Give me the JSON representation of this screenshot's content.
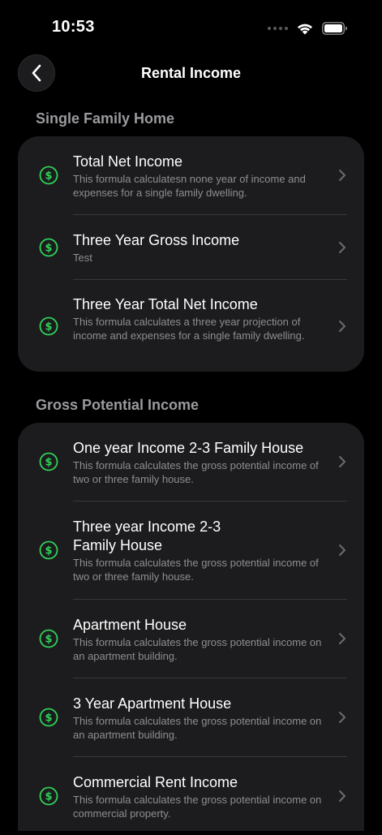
{
  "status_bar": {
    "time": "10:53"
  },
  "nav": {
    "title": "Rental Income",
    "back_icon": "chevron-left-icon"
  },
  "colors": {
    "background": "#000000",
    "card": "#1c1c1e",
    "accent_green": "#30d158",
    "secondary_text": "#8e8e93",
    "section_header": "#9a9a9f"
  },
  "sections": [
    {
      "header": "Single Family Home",
      "items": [
        {
          "title": "Total Net Income",
          "description": "This formula calculatesn none  year of income and expenses for a single family dwelling.",
          "icon": "dollar-circle-icon"
        },
        {
          "title": "Three Year Gross Income",
          "description": "Test",
          "icon": "dollar-circle-icon"
        },
        {
          "title": "Three Year Total Net Income",
          "description": "This formula calculates a three  year projection of income and expenses for a single family dwelling.",
          "icon": "dollar-circle-icon"
        }
      ]
    },
    {
      "header": "Gross Potential Income",
      "items": [
        {
          "title": "One year Income 2-3 Family House",
          "description": "This formula calculates the gross potential income of two or three family house.",
          "icon": "dollar-circle-icon"
        },
        {
          "title": "Three  year Income 2-3 Family House",
          "description": "This formula calculates the gross potential income of two or three family house.",
          "icon": "dollar-circle-icon"
        },
        {
          "title": "Apartment House",
          "description": "This formula calculates the gross potential income on an apartment building.",
          "icon": "dollar-circle-icon"
        },
        {
          "title": "3 Year Apartment House",
          "description": "This formula calculates the gross potential income on an apartment building.",
          "icon": "dollar-circle-icon"
        },
        {
          "title": "Commercial Rent Income",
          "description": "This formula calculates the gross potential income on commercial property.",
          "icon": "dollar-circle-icon"
        }
      ]
    }
  ]
}
